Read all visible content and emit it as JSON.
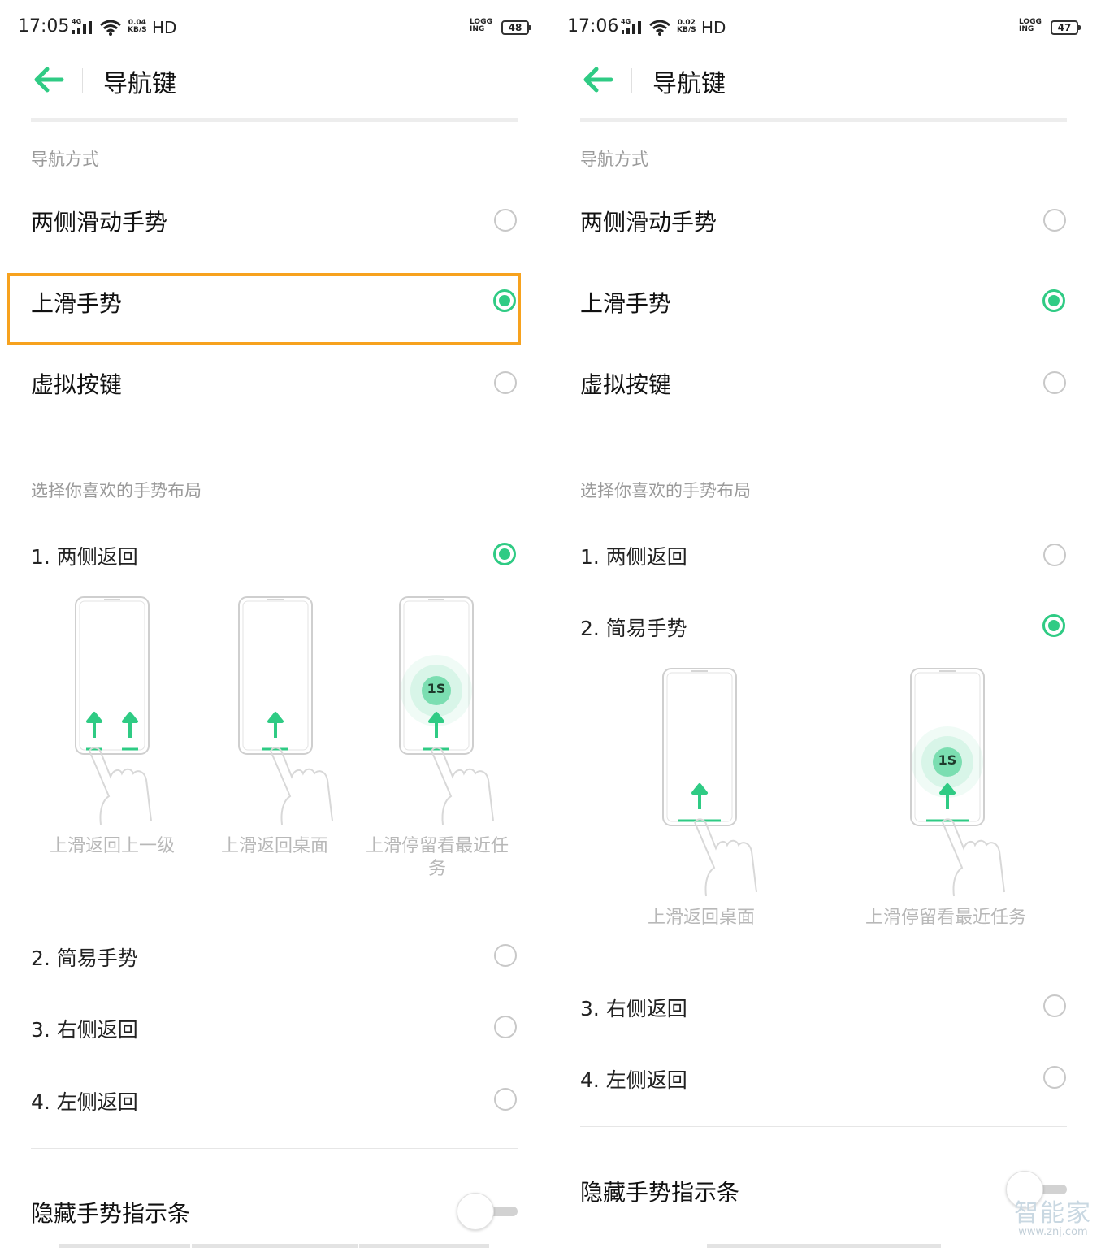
{
  "left": {
    "status": {
      "time": "17:05",
      "network": "4G",
      "speed_value": "0.04",
      "speed_unit": "KB/S",
      "hd": "HD",
      "logg_top": "LOGG",
      "logg_bottom": "ING",
      "battery": "48"
    },
    "header": {
      "title": "导航键"
    },
    "nav_section": {
      "header": "导航方式",
      "options": [
        {
          "label": "两侧滑动手势",
          "checked": false
        },
        {
          "label": "上滑手势",
          "checked": true
        },
        {
          "label": "虚拟按键",
          "checked": false
        }
      ]
    },
    "layout_section": {
      "header": "选择你喜欢的手势布局",
      "options": [
        {
          "label": "1. 两侧返回",
          "checked": true
        },
        {
          "label": "2. 简易手势",
          "checked": false
        },
        {
          "label": "3. 右侧返回",
          "checked": false
        },
        {
          "label": "4. 左侧返回",
          "checked": false
        }
      ],
      "illustrations": [
        {
          "caption": "上滑返回上一级"
        },
        {
          "caption": "上滑返回桌面"
        },
        {
          "caption": "上滑停留看最近任务",
          "badge": "1S"
        }
      ]
    },
    "hide_bar": {
      "label": "隐藏手势指示条",
      "on": false
    }
  },
  "right": {
    "status": {
      "time": "17:06",
      "network": "4G",
      "speed_value": "0.02",
      "speed_unit": "KB/S",
      "hd": "HD",
      "logg_top": "LOGG",
      "logg_bottom": "ING",
      "battery": "47"
    },
    "header": {
      "title": "导航键"
    },
    "nav_section": {
      "header": "导航方式",
      "options": [
        {
          "label": "两侧滑动手势",
          "checked": false
        },
        {
          "label": "上滑手势",
          "checked": true
        },
        {
          "label": "虚拟按键",
          "checked": false
        }
      ]
    },
    "layout_section": {
      "header": "选择你喜欢的手势布局",
      "options": [
        {
          "label": "1. 两侧返回",
          "checked": false
        },
        {
          "label": "2. 简易手势",
          "checked": true
        },
        {
          "label": "3. 右侧返回",
          "checked": false
        },
        {
          "label": "4. 左侧返回",
          "checked": false
        }
      ],
      "illustrations": [
        {
          "caption": "上滑返回桌面"
        },
        {
          "caption": "上滑停留看最近任务",
          "badge": "1S"
        }
      ]
    },
    "hide_bar": {
      "label": "隐藏手势指示条",
      "on": false
    }
  },
  "watermark": {
    "brand": "智能家",
    "url": "www.znj.com"
  },
  "colors": {
    "accent": "#2fcb84",
    "highlight": "#f7a21e",
    "muted_text": "#9a9a9a"
  },
  "icons": {
    "back": "arrow-left-icon",
    "wifi": "wifi-icon",
    "signal": "signal-icon",
    "battery": "battery-icon"
  }
}
